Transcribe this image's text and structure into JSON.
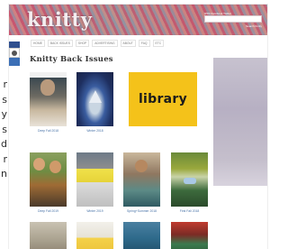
{
  "left_text_fragments": [
    "r",
    "s",
    "y",
    "s",
    "d",
    "r",
    "n"
  ],
  "site": {
    "logo": "knitty",
    "header_links": "RSS  Facebook  Twitter",
    "header_meta": "Search Knitty"
  },
  "nav": {
    "items": [
      "HOME",
      "BACK ISSUES",
      "SHOP",
      "ADVERTISING",
      "ABOUT",
      "FAQ",
      "ETC"
    ]
  },
  "page": {
    "title": "Knitty Back Issues"
  },
  "issues": [
    {
      "caption": "Deep Fall 2018"
    },
    {
      "caption": "Winter 2018"
    },
    {
      "caption": "library"
    },
    {
      "caption": "Deep Fall 2019"
    },
    {
      "caption": "Winter 2019"
    },
    {
      "caption": "Spring+Summer 2018"
    },
    {
      "caption": "First Fall 2018"
    }
  ]
}
